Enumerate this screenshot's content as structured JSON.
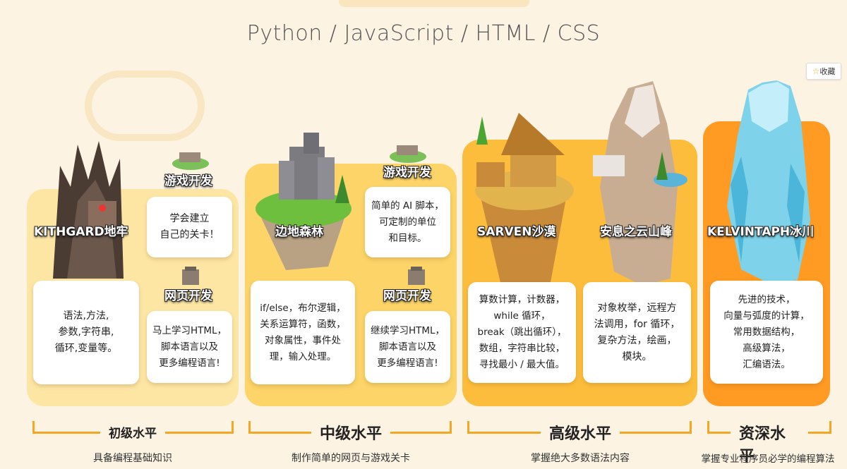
{
  "subtitle": "Python / JavaScript / HTML / CSS",
  "favorite": {
    "icon": "star-icon",
    "label": "收藏"
  },
  "worlds": [
    {
      "name": "KITHGARD地牢",
      "desc": "语法,方法,\n参数,字符串,\n循环,变量等。"
    },
    {
      "name": "边地森林",
      "desc": "if/else，布尔逻辑，\n关系运算符，函数，\n对象属性，事件处\n理，输入处理。"
    },
    {
      "name": "SARVEN沙漠",
      "desc": "算数计算，计数器，\nwhile 循环，\nbreak（跳出循环），\n数组，字符串比较，\n寻找最小 / 最大值。"
    },
    {
      "name": "安息之云山峰",
      "desc": "对象枚举，远程方\n法调用，for 循环，\n复杂方法，绘画，\n模块。"
    },
    {
      "name": "KELVINTAPH冰川",
      "desc": "先进的技术，\n向量与弧度的计算，\n常用数据结构，\n高级算法，\n汇编语法。"
    }
  ],
  "side_tracks": [
    {
      "title": "游戏开发",
      "text": "学会建立\n自己的关卡！"
    },
    {
      "title": "网页开发",
      "text": "马上学习HTML，\n脚本语言以及\n更多编程语言!"
    },
    {
      "title": "游戏开发",
      "text": "简单的 AI 脚本，\n可定制的单位\n和目标。"
    },
    {
      "title": "网页开发",
      "text": "继续学习HTML，\n脚本语言以及\n更多编程语言!"
    }
  ],
  "levels": [
    {
      "title": "初级水平",
      "sub": "具备编程基础知识"
    },
    {
      "title": "中级水平",
      "sub": "制作简单的网页与游戏关卡"
    },
    {
      "title": "高级水平",
      "sub": "掌握绝大多数语法内容"
    },
    {
      "title": "资深水平",
      "sub": "掌握专业程序员必学的编程算法"
    }
  ],
  "colors": {
    "beginner": "#fde6a4",
    "intermediate": "#fcd468",
    "advanced": "#fdbd3c",
    "expert": "#ff9a22",
    "accent": "#f5a623"
  }
}
